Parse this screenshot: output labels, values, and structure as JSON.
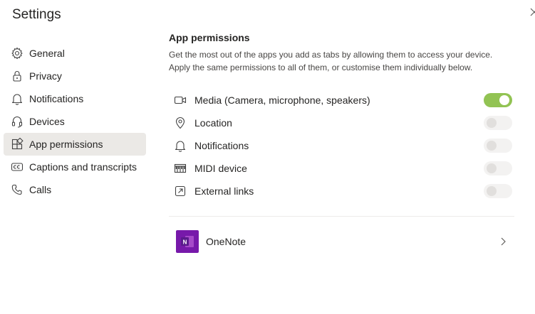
{
  "title": "Settings",
  "nav": {
    "items": [
      {
        "label": "General",
        "icon": "gear-icon",
        "active": false
      },
      {
        "label": "Privacy",
        "icon": "lock-icon",
        "active": false
      },
      {
        "label": "Notifications",
        "icon": "bell-icon",
        "active": false
      },
      {
        "label": "Devices",
        "icon": "headset-icon",
        "active": false
      },
      {
        "label": "App permissions",
        "icon": "apps-icon",
        "active": true
      },
      {
        "label": "Captions and transcripts",
        "icon": "cc-icon",
        "active": false
      },
      {
        "label": "Calls",
        "icon": "phone-icon",
        "active": false
      }
    ]
  },
  "main": {
    "section_title": "App permissions",
    "description_line1": "Get the most out of the apps you add as tabs by allowing them to access your device.",
    "description_line2": "Apply the same permissions to all of them, or customise them individually below.",
    "permissions": [
      {
        "label": "Media (Camera, microphone, speakers)",
        "icon": "video-camera-icon",
        "enabled": true
      },
      {
        "label": "Location",
        "icon": "location-pin-icon",
        "enabled": false
      },
      {
        "label": "Notifications",
        "icon": "bell-icon",
        "enabled": false
      },
      {
        "label": "MIDI device",
        "icon": "piano-keys-icon",
        "enabled": false
      },
      {
        "label": "External links",
        "icon": "external-link-icon",
        "enabled": false
      }
    ],
    "app": {
      "label": "OneNote",
      "icon": "onenote-icon",
      "logo_letter": "N"
    }
  },
  "colors": {
    "toggle_on": "#92c353",
    "active_nav_bg": "#ebe9e6",
    "onenote_purple": "#7719aa"
  }
}
